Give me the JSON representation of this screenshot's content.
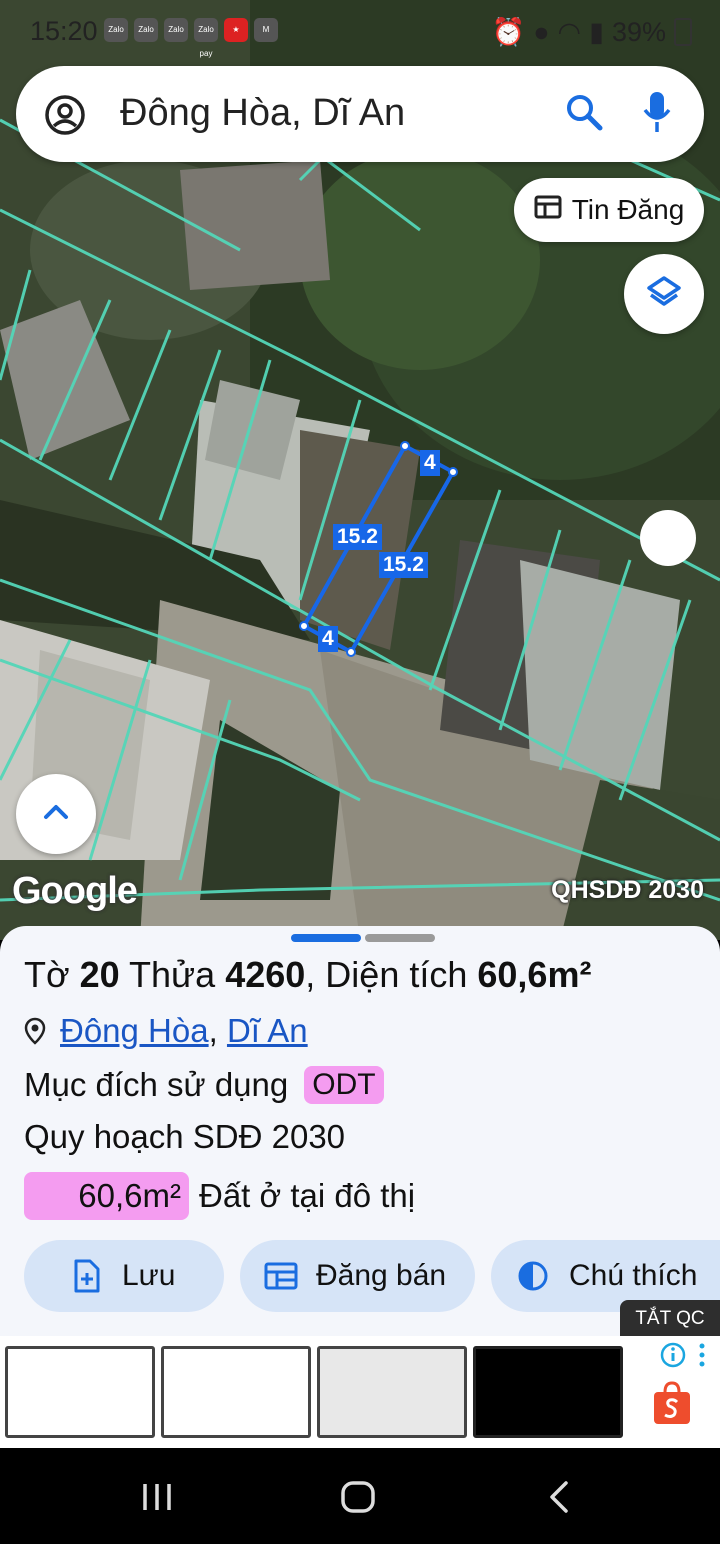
{
  "status_bar": {
    "time": "15:20",
    "app_icons": [
      "Zalo",
      "Zalo",
      "Zalo",
      "Zalo pay",
      "★",
      "M"
    ],
    "battery": "39%"
  },
  "search": {
    "query": "Đông Hòa, Dĩ An"
  },
  "map": {
    "tin_dang_label": "Tin Đăng",
    "google_logo": "Google",
    "overlay_label": "QHSDĐ 2030",
    "dims": {
      "top": "4",
      "left": "15.2",
      "right": "15.2",
      "bottom": "4"
    },
    "parcel_color": "#1767e8",
    "boundary_color": "#54d6b8"
  },
  "parcel": {
    "to_label": "Tờ",
    "to_value": "20",
    "thua_label": "Thửa",
    "thua_value": "4260",
    "dien_tich_label": "Diện tích",
    "dien_tich_value": "60,6m²",
    "ward": "Đông Hòa",
    "city": "Dĩ An",
    "muc_dich_label": "Mục đích sử dụng",
    "muc_dich_code": "ODT",
    "quy_hoach_label": "Quy hoạch SDĐ 2030",
    "area_value": "60,6m²",
    "area_desc": "Đất ở tại đô thị",
    "badge_color": "#f49cf0"
  },
  "actions": {
    "save": "Lưu",
    "post_sale": "Đăng bán",
    "legend": "Chú thích"
  },
  "ad": {
    "hide_label": "TẮT QC"
  }
}
